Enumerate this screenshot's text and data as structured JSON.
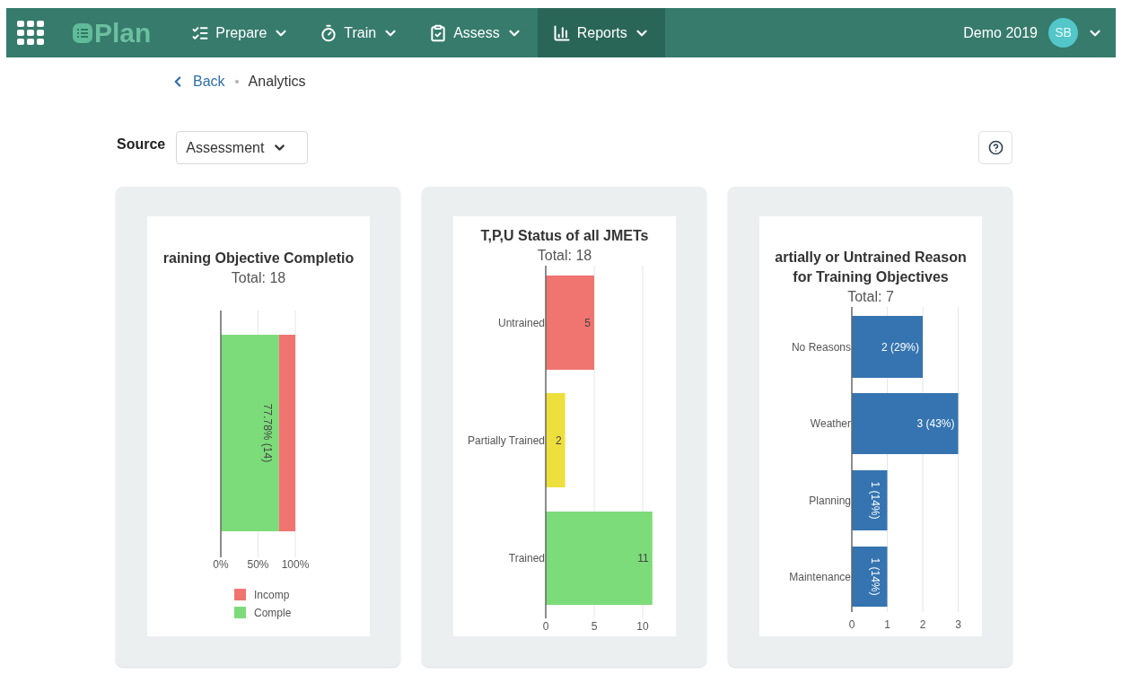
{
  "nav": {
    "logo": "Plan",
    "items": [
      {
        "label": "Prepare",
        "selected": false
      },
      {
        "label": "Train",
        "selected": false
      },
      {
        "label": "Assess",
        "selected": false
      },
      {
        "label": "Reports",
        "selected": true
      }
    ],
    "user": {
      "name": "Demo 2019",
      "initials": "SB"
    }
  },
  "breadcrumb": {
    "back": "Back",
    "current": "Analytics"
  },
  "source": {
    "label": "Source",
    "value": "Assessment"
  },
  "charts": [
    {
      "subtitle": "Total: 18",
      "chart_data": {
        "type": "bar",
        "orientation": "horizontal",
        "title": "raining Objective Completio",
        "stacked": true,
        "legend": "bottom",
        "xlim": [
          0,
          100
        ],
        "xticks": [
          {
            "value": 0,
            "label": "0%"
          },
          {
            "value": 50,
            "label": "50%"
          },
          {
            "value": 100,
            "label": "100%"
          }
        ],
        "series": [
          {
            "name": "Incomp",
            "color": "#f07470",
            "values": [
              22
            ]
          },
          {
            "name": "Comple",
            "color": "#7ddc7a",
            "values": [
              78
            ]
          }
        ],
        "value_labels": [
          "77.78% (14)"
        ]
      }
    },
    {
      "subtitle": "Total: 18",
      "chart_data": {
        "type": "bar",
        "orientation": "horizontal",
        "title": "T,P,U Status of all JMETs",
        "categories": [
          "Untrained",
          "Partially Trained",
          "Trained"
        ],
        "xlim": [
          0,
          11
        ],
        "xticks": [
          {
            "value": 0,
            "label": "0"
          },
          {
            "value": 5,
            "label": "5"
          },
          {
            "value": 10,
            "label": "10"
          }
        ],
        "values": [
          5,
          2,
          11
        ],
        "colors": [
          "#f07470",
          "#ede03c",
          "#7ddc7a"
        ],
        "data_labels": true
      }
    },
    {
      "subtitle": "Total: 7",
      "chart_data": {
        "type": "bar",
        "orientation": "horizontal",
        "title": "artially or Untrained Reason\nfor Training Objectives",
        "categories": [
          "No Reasons",
          "Weather",
          "Planning",
          "Maintenance"
        ],
        "xlim": [
          0,
          3
        ],
        "xticks": [
          {
            "value": 0,
            "label": "0"
          },
          {
            "value": 1,
            "label": "1"
          },
          {
            "value": 2,
            "label": "2"
          },
          {
            "value": 3,
            "label": "3"
          }
        ],
        "values": [
          2,
          3,
          1,
          1
        ],
        "colors": [
          "#3574b0",
          "#3574b0",
          "#3574b0",
          "#3574b0"
        ],
        "value_labels": [
          "2 (29%)",
          "3 (43%)",
          "1 (14%)",
          "1 (14%)"
        ]
      }
    }
  ]
}
